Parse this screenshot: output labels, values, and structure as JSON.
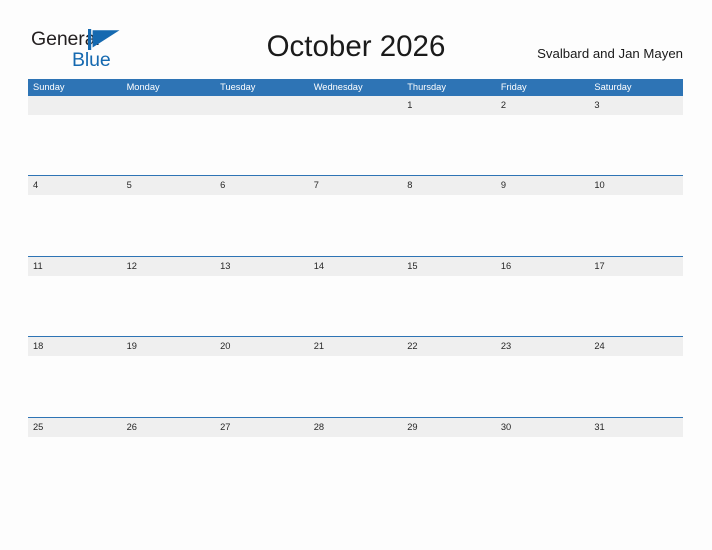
{
  "logo": {
    "word_general": "General",
    "word_blue": "Blue",
    "flag_icon": "blue-flag-icon",
    "colors": {
      "general_text": "#231f20",
      "blue_text": "#1569b0",
      "flag": "#1569b0"
    }
  },
  "header": {
    "title": "October 2026",
    "month": "October",
    "year": "2026",
    "location": "Svalbard and Jan Mayen"
  },
  "theme": {
    "accent": "#2e74b5",
    "header_text": "#ffffff",
    "band": "#efefef",
    "page_background": "#fdfdfd",
    "body_text": "#262626"
  },
  "calendar": {
    "weekdays": [
      "Sunday",
      "Monday",
      "Tuesday",
      "Wednesday",
      "Thursday",
      "Friday",
      "Saturday"
    ],
    "weeks": [
      [
        "",
        "",
        "",
        "",
        "1",
        "2",
        "3"
      ],
      [
        "4",
        "5",
        "6",
        "7",
        "8",
        "9",
        "10"
      ],
      [
        "11",
        "12",
        "13",
        "14",
        "15",
        "16",
        "17"
      ],
      [
        "18",
        "19",
        "20",
        "21",
        "22",
        "23",
        "24"
      ],
      [
        "25",
        "26",
        "27",
        "28",
        "29",
        "30",
        "31"
      ]
    ]
  }
}
